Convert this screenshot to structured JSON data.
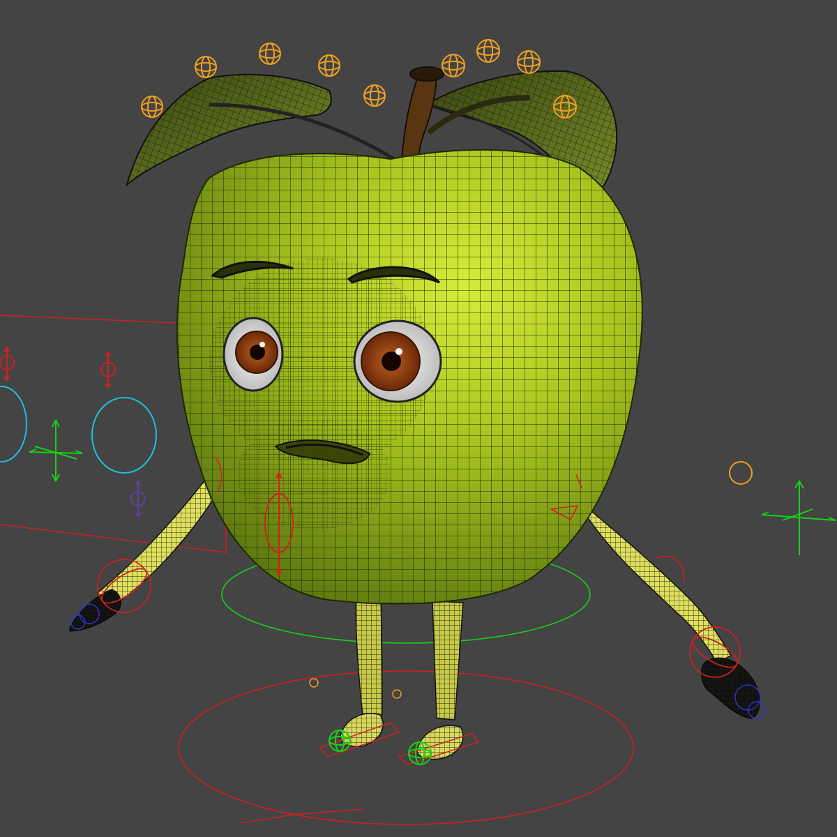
{
  "viewport": {
    "description_free": true,
    "background_color": "#444444"
  },
  "model": {
    "icon": "apple-character-wireframe",
    "body_color": "#a9c51e",
    "body_highlight": "#d6ec3a",
    "body_shadow": "#5f7a0f",
    "wire_color": "#1f2a05",
    "limb_color": "#e0e060",
    "leaf_color": "#5a6e1a",
    "stem_color": "#5a3512",
    "iris_color": "#8a3e10"
  },
  "rig": {
    "red_control": "#d02020",
    "green_control": "#18d018",
    "cyan_control": "#20c0e0",
    "orange_control": "#f0a020",
    "purple_control": "#6040a0",
    "blue_control": "#3030d0"
  }
}
